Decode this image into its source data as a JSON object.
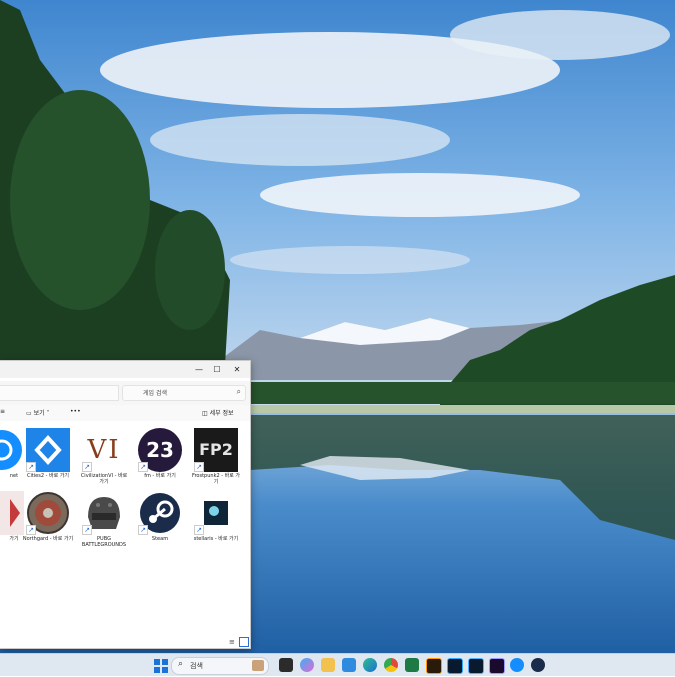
{
  "explorer": {
    "controls": {
      "minimize": "—",
      "maximize": "☐",
      "close": "✕"
    },
    "search_placeholder": "게임 검색",
    "toolbar": {
      "view_label": "보기",
      "more_label": "•••",
      "details_label": "세부 정보"
    },
    "files": [
      {
        "label": "net",
        "icon": "battlenet-icon"
      },
      {
        "label": "Cities2 - 바로 가기",
        "icon": "cities2-icon"
      },
      {
        "label": "CivilizationVI - 바로 가기",
        "thumb_text": "VI",
        "icon": "civilization-icon"
      },
      {
        "label": "fm - 바로 가기",
        "thumb_text": "23",
        "icon": "football-manager-icon"
      },
      {
        "label": "Frostpunk2 - 바로 가기",
        "thumb_text": "FP2",
        "icon": "frostpunk2-icon"
      },
      {
        "label": "가기",
        "icon": "game-icon"
      },
      {
        "label": "Northgard - 바로 가기",
        "icon": "northgard-icon"
      },
      {
        "label": "PUBG BATTLEGROUNDS",
        "icon": "pubg-icon"
      },
      {
        "label": "Steam",
        "icon": "steam-icon"
      },
      {
        "label": "stellaris - 바로 가기",
        "icon": "stellaris-icon"
      }
    ]
  },
  "taskbar": {
    "search_label": "검색",
    "icons": [
      "windows-start-icon",
      "search-icon",
      "widgets-icon",
      "task-view-icon",
      "copilot-icon",
      "file-explorer-icon",
      "store-icon",
      "edge-icon",
      "chrome-icon",
      "excel-icon",
      "illustrator-icon",
      "photoshop-icon",
      "lightroom-icon",
      "premiere-icon",
      "battlenet-icon",
      "steam-icon"
    ]
  },
  "colors": {
    "taskbar_bg": "#dfe7f1",
    "window_bg": "#ffffff",
    "sky": "#5a9bd6",
    "lake": "#2a6db0"
  }
}
